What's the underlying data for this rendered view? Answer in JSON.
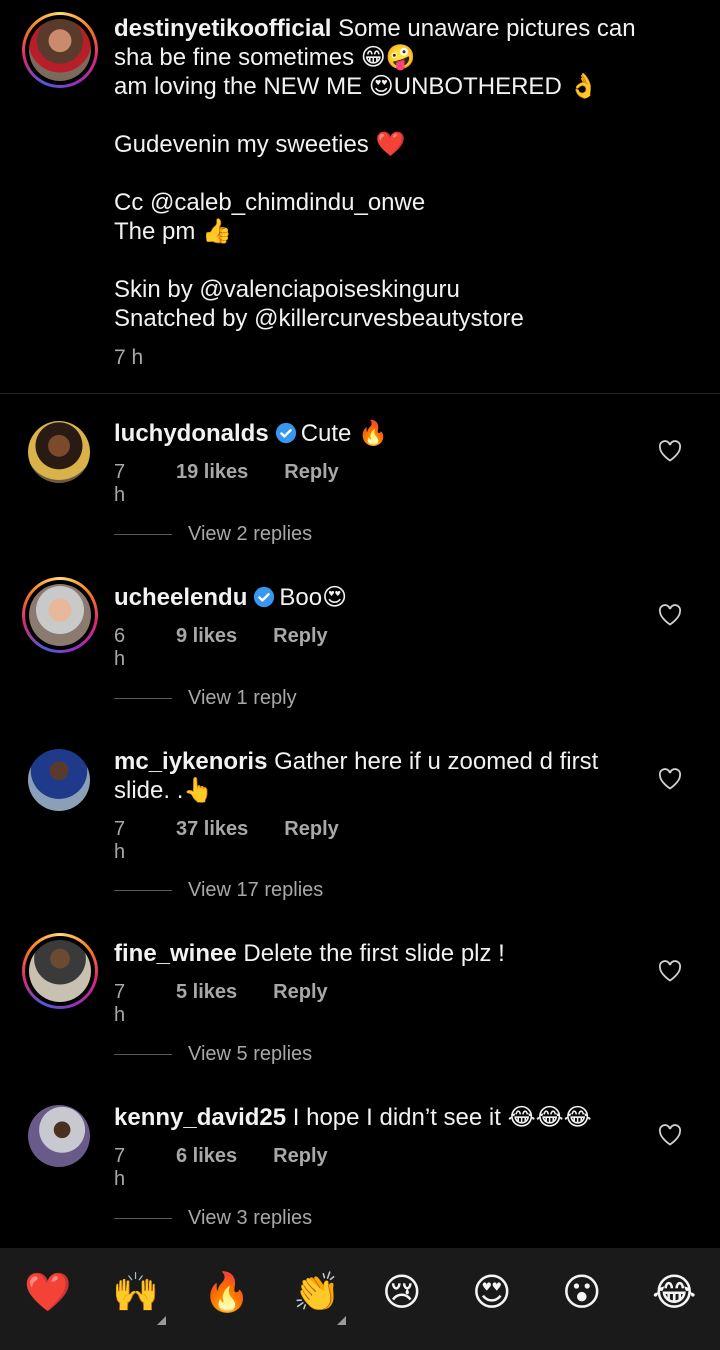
{
  "post": {
    "username": "destinyetikoofficial",
    "caption_line1": "Some unaware pictures can",
    "caption_line2": "sha be fine sometimes 😁🤪",
    "caption_line3": "am loving the NEW ME 😍UNBOTHERED 👌",
    "caption_line4": "Gudevenin my sweeties ❤️",
    "caption_line5": "Cc @caleb_chimdindu_onwe",
    "caption_line6": "The pm 👍",
    "caption_line7": "Skin by @valenciapoiseskinguru",
    "caption_line8": "Snatched by @killercurvesbeautystore",
    "time": "7 h"
  },
  "comments": [
    {
      "user": "luchydonalds",
      "verified": true,
      "text": "Cute 🔥",
      "time": "7 h",
      "likes": "19 likes",
      "reply": "Reply",
      "view_replies": "View 2 replies"
    },
    {
      "user": "ucheelendu",
      "verified": true,
      "text": "Boo😍",
      "time": "6 h",
      "likes": "9 likes",
      "reply": "Reply",
      "view_replies": "View 1 reply"
    },
    {
      "user": "mc_iykenoris",
      "verified": false,
      "text": "Gather here if u zoomed d first slide. .👆",
      "time": "7 h",
      "likes": "37 likes",
      "reply": "Reply",
      "view_replies": "View 17 replies"
    },
    {
      "user": "fine_winee",
      "verified": false,
      "text": "Delete the first slide  plz !",
      "time": "7 h",
      "likes": "5 likes",
      "reply": "Reply",
      "view_replies": "View 5 replies"
    },
    {
      "user": "kenny_david25",
      "verified": false,
      "text": "I hope I didn’t see it 😂😂😂",
      "time": "7 h",
      "likes": "6 likes",
      "reply": "Reply",
      "view_replies": "View 3 replies"
    }
  ],
  "emoji_bar": {
    "e1": "❤️",
    "e2": "🙌",
    "e3": "🔥",
    "e4": "👏",
    "e5": "😢",
    "e6": "😍",
    "e7": "😮",
    "e8": "😂"
  },
  "colors": {
    "background": "#000000",
    "muted_text": "#a8a8a8",
    "verified_blue": "#3897f0",
    "emoji_bar_bg": "#1a1a1a"
  }
}
